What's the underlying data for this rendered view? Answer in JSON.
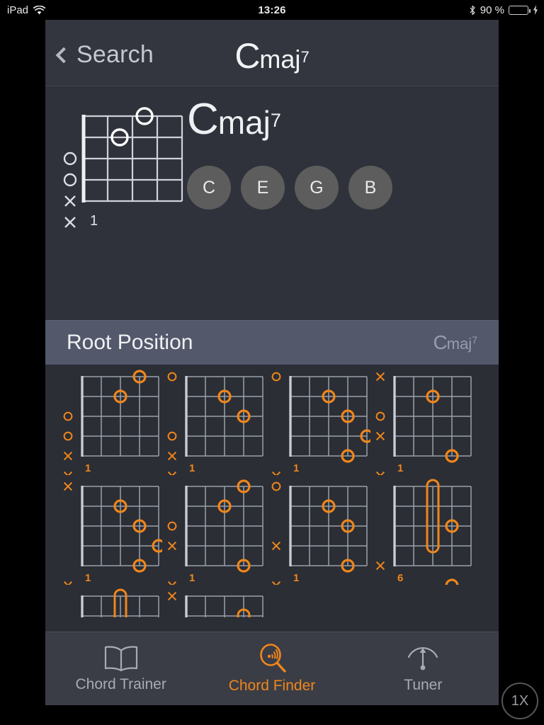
{
  "status_bar": {
    "device": "iPad",
    "wifi_icon": "wifi-icon",
    "time": "13:26",
    "bluetooth_icon": "bluetooth-icon",
    "battery_text": "90 %",
    "battery_level": 90,
    "battery_color": "#4cd964",
    "charging_icon": "lightning-bolt-icon"
  },
  "nav_bar": {
    "back_label": "Search",
    "back_icon": "chevron-left-icon",
    "title": {
      "root": "C",
      "quality": "maj",
      "superscript": "7"
    }
  },
  "hero": {
    "chord": {
      "root": "C",
      "quality": "maj",
      "superscript": "7"
    },
    "notes": [
      "C",
      "E",
      "G",
      "B"
    ],
    "diagram": {
      "strings": 6,
      "frets": 4,
      "start_fret": "1",
      "dots": [
        {
          "string": 1,
          "fret": 3
        },
        {
          "string": 2,
          "fret": 2
        }
      ],
      "open_muted": [
        {
          "string": 3,
          "mark": "O"
        },
        {
          "string": 4,
          "mark": "O"
        },
        {
          "string": 5,
          "mark": "X"
        },
        {
          "string": 6,
          "mark": "X"
        }
      ]
    }
  },
  "section": {
    "title": "Root Position",
    "chord": {
      "root": "C",
      "quality": "maj",
      "superscript": "7"
    }
  },
  "voicings": [
    {
      "start_fret": "1",
      "dots": [
        {
          "string": 1,
          "fret": 3
        },
        {
          "string": 2,
          "fret": 2
        }
      ],
      "open_muted": [
        {
          "string": 3,
          "mark": "O"
        },
        {
          "string": 4,
          "mark": "O"
        },
        {
          "string": 5,
          "mark": "X"
        },
        {
          "string": 6,
          "mark": "X"
        }
      ],
      "barres": []
    },
    {
      "start_fret": "1",
      "dots": [
        {
          "string": 2,
          "fret": 2
        },
        {
          "string": 3,
          "fret": 3
        }
      ],
      "open_muted": [
        {
          "string": 1,
          "mark": "O"
        },
        {
          "string": 4,
          "mark": "O"
        },
        {
          "string": 5,
          "mark": "X"
        },
        {
          "string": 6,
          "mark": "X"
        }
      ],
      "barres": []
    },
    {
      "start_fret": "1",
      "dots": [
        {
          "string": 2,
          "fret": 2
        },
        {
          "string": 3,
          "fret": 3
        },
        {
          "string": 4,
          "fret": 4
        },
        {
          "string": 5,
          "fret": 3
        }
      ],
      "open_muted": [
        {
          "string": 1,
          "mark": "O"
        },
        {
          "string": 6,
          "mark": "X"
        }
      ],
      "barres": []
    },
    {
      "start_fret": "1",
      "dots": [
        {
          "string": 2,
          "fret": 2
        },
        {
          "string": 5,
          "fret": 3
        }
      ],
      "open_muted": [
        {
          "string": 1,
          "mark": "X"
        },
        {
          "string": 3,
          "mark": "O"
        },
        {
          "string": 4,
          "mark": "X"
        },
        {
          "string": 6,
          "mark": "X"
        }
      ],
      "barres": []
    },
    {
      "start_fret": "1",
      "dots": [
        {
          "string": 2,
          "fret": 2
        },
        {
          "string": 3,
          "fret": 3
        },
        {
          "string": 4,
          "fret": 4
        },
        {
          "string": 5,
          "fret": 3
        }
      ],
      "open_muted": [
        {
          "string": 1,
          "mark": "X"
        },
        {
          "string": 6,
          "mark": "X"
        }
      ],
      "barres": []
    },
    {
      "start_fret": "1",
      "dots": [
        {
          "string": 1,
          "fret": 3
        },
        {
          "string": 2,
          "fret": 2
        },
        {
          "string": 5,
          "fret": 3
        }
      ],
      "open_muted": [
        {
          "string": 3,
          "mark": "O"
        },
        {
          "string": 4,
          "mark": "X"
        },
        {
          "string": 6,
          "mark": "X"
        }
      ],
      "barres": []
    },
    {
      "start_fret": "1",
      "dots": [
        {
          "string": 2,
          "fret": 2
        },
        {
          "string": 3,
          "fret": 3
        },
        {
          "string": 5,
          "fret": 3
        }
      ],
      "open_muted": [
        {
          "string": 1,
          "mark": "O"
        },
        {
          "string": 4,
          "mark": "X"
        },
        {
          "string": 6,
          "mark": "X"
        }
      ],
      "barres": []
    },
    {
      "start_fret": "6",
      "dots": [
        {
          "string": 3,
          "fret": 3
        },
        {
          "string": 6,
          "fret": 3
        }
      ],
      "open_muted": [
        {
          "string": 5,
          "mark": "X"
        }
      ],
      "barres": [
        {
          "fret": 2,
          "from_string": 1,
          "to_string": 4
        }
      ]
    }
  ],
  "voicings_partial_row": [
    {
      "barres": [
        {
          "fret": 2,
          "from_string": 1,
          "to_string": 2
        }
      ],
      "open_muted": []
    },
    {
      "barres": [
        {
          "fret": 3,
          "from_string": 2,
          "to_string": 2
        }
      ],
      "open_muted": [
        {
          "string": 1,
          "mark": "X"
        }
      ]
    }
  ],
  "tab_bar": {
    "tabs": [
      {
        "label": "Chord Trainer",
        "icon": "book-icon",
        "active": false
      },
      {
        "label": "Chord Finder",
        "icon": "magnifier-waves-icon",
        "active": true
      },
      {
        "label": "Tuner",
        "icon": "tuner-needle-icon",
        "active": false
      }
    ],
    "active_color": "#f0861b",
    "inactive_color": "#a8abb3"
  },
  "scale_badge": {
    "label": "1X"
  },
  "theme": {
    "background": "#2f323a",
    "panel": "#2b2e35",
    "header_band": "#53586b",
    "accent": "#f0861b",
    "diagram_line_light": "#cfd2d8",
    "diagram_line_dim": "#9aa0ab"
  }
}
